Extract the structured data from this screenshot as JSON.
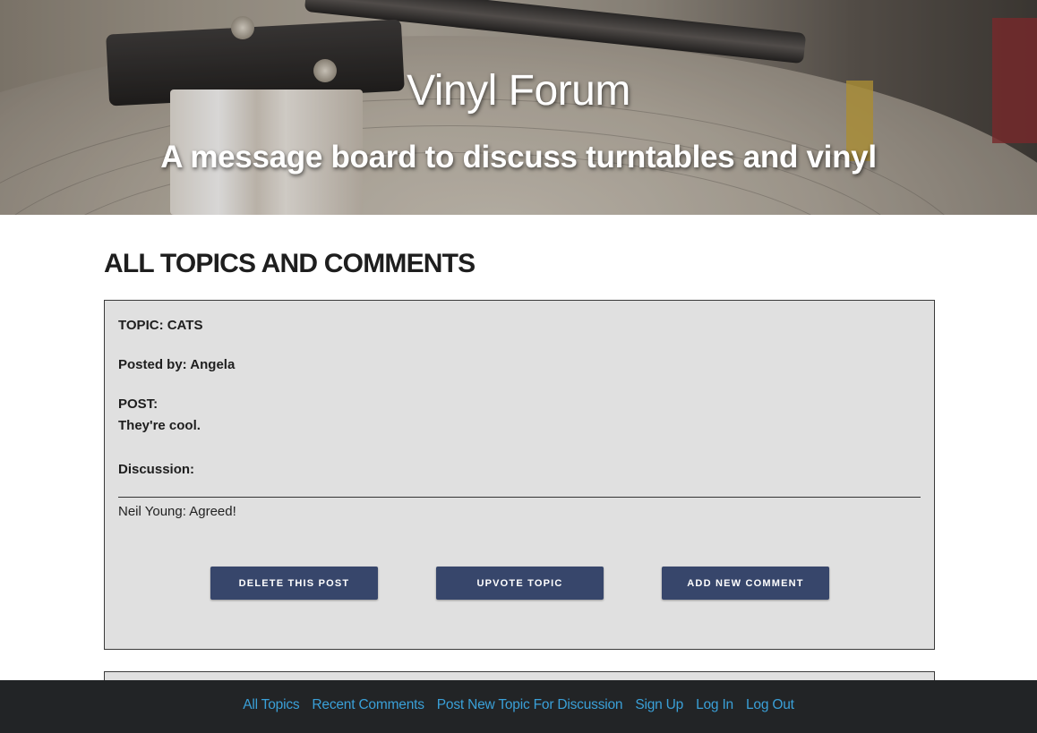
{
  "header": {
    "title": "Vinyl Forum",
    "subtitle": "A message board to discuss turntables and vinyl"
  },
  "main": {
    "heading": "ALL TOPICS AND COMMENTS",
    "topics": [
      {
        "topic_line": "TOPIC: CATS",
        "posted_by_line": "Posted by: Angela",
        "post_label": "POST:",
        "post_text": "They're cool.",
        "discussion_label": "Discussion:",
        "comments": [
          {
            "text": "Neil Young: Agreed!"
          }
        ],
        "buttons": {
          "delete": "Delete This Post",
          "upvote": "Upvote Topic",
          "add_comment": "Add New Comment"
        }
      }
    ]
  },
  "footer": {
    "links": [
      "All Topics",
      "Recent Comments",
      "Post New Topic For Discussion",
      "Sign Up",
      "Log In",
      "Log Out"
    ],
    "link_color": "#3aa0d8",
    "background": "#222426"
  },
  "colors": {
    "button_bg": "#37466b",
    "card_bg": "#e0e0e0"
  },
  "icons": {
    "hero_image": "turntable-cartridge-image"
  }
}
